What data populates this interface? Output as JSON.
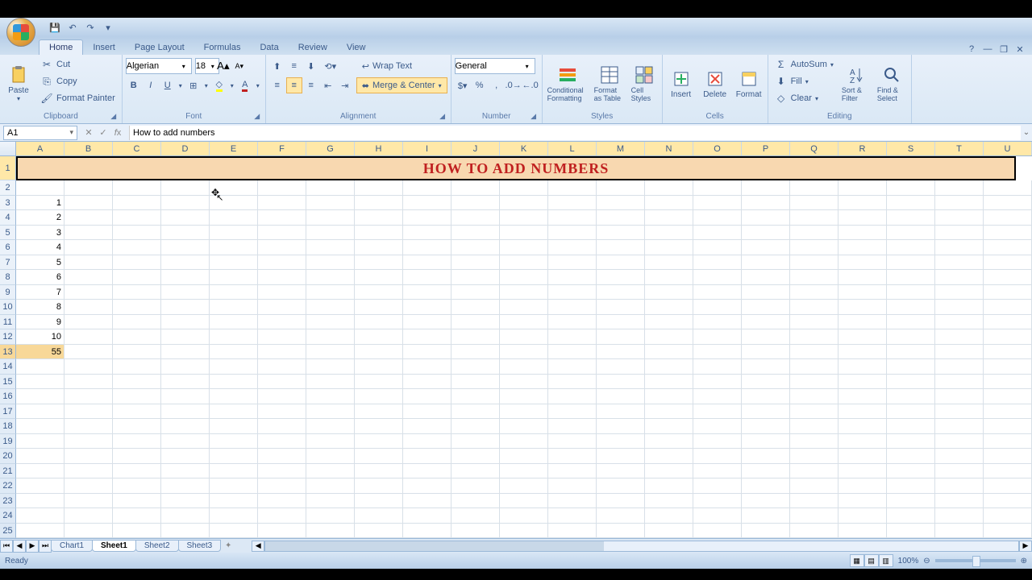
{
  "qat": {
    "save": "💾",
    "undo": "↶",
    "redo": "↷"
  },
  "tabs": [
    "Home",
    "Insert",
    "Page Layout",
    "Formulas",
    "Data",
    "Review",
    "View"
  ],
  "active_tab": "Home",
  "ribbon": {
    "clipboard": {
      "label": "Clipboard",
      "paste": "Paste",
      "cut": "Cut",
      "copy": "Copy",
      "painter": "Format Painter"
    },
    "font": {
      "label": "Font",
      "name": "Algerian",
      "size": "18"
    },
    "alignment": {
      "label": "Alignment",
      "wrap": "Wrap Text",
      "merge": "Merge & Center"
    },
    "number": {
      "label": "Number",
      "format": "General"
    },
    "styles": {
      "label": "Styles",
      "cond": "Conditional Formatting",
      "table": "Format as Table",
      "cell": "Cell Styles"
    },
    "cells": {
      "label": "Cells",
      "insert": "Insert",
      "delete": "Delete",
      "format": "Format"
    },
    "editing": {
      "label": "Editing",
      "autosum": "AutoSum",
      "fill": "Fill",
      "clear": "Clear",
      "sort": "Sort & Filter",
      "find": "Find & Select"
    }
  },
  "name_box": "A1",
  "formula_bar": "How to add numbers",
  "columns": [
    "A",
    "B",
    "C",
    "D",
    "E",
    "F",
    "G",
    "H",
    "I",
    "J",
    "K",
    "L",
    "M",
    "N",
    "O",
    "P",
    "Q",
    "R",
    "S",
    "T",
    "U"
  ],
  "title_cell": "How to add numbers",
  "data_values": [
    "1",
    "2",
    "3",
    "4",
    "5",
    "6",
    "7",
    "8",
    "9",
    "10",
    "55"
  ],
  "sheet_tabs": [
    "Chart1",
    "Sheet1",
    "Sheet2",
    "Sheet3"
  ],
  "active_sheet": "Sheet1",
  "status": "Ready",
  "zoom": "100%"
}
